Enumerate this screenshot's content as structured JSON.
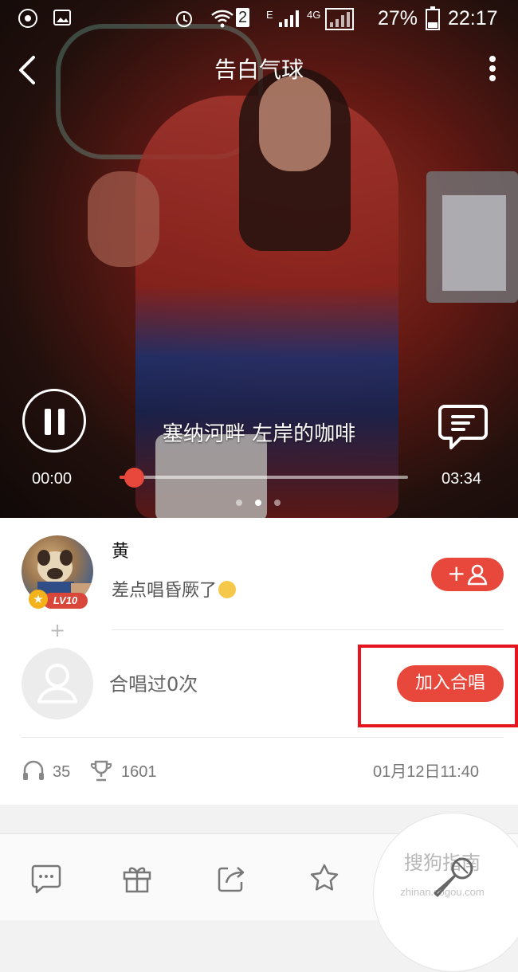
{
  "status_bar": {
    "network_label": "2",
    "signal_e": "E",
    "signal_4g": "4G",
    "battery": "27%",
    "time": "22:17"
  },
  "header": {
    "title": "告白气球"
  },
  "player": {
    "lyric": "塞纳河畔 左岸的咖啡",
    "current_time": "00:00",
    "total_time": "03:34",
    "progress": 0.05,
    "page_count": 3,
    "active_page": 1
  },
  "singer": {
    "name": "黄",
    "level": "LV10",
    "description": "差点唱昏厥了",
    "follow_plus": "+"
  },
  "duet": {
    "plus": "+",
    "count_text": "合唱过0次",
    "join_label": "加入合唱"
  },
  "stats": {
    "listens": "35",
    "trophies": "1601",
    "date": "01月12日11:40"
  },
  "watermark": {
    "text": "搜狗指南",
    "sub": "zhinan.sogou.com"
  },
  "colors": {
    "accent": "#e8473b",
    "highlight_box": "#e6141f"
  }
}
